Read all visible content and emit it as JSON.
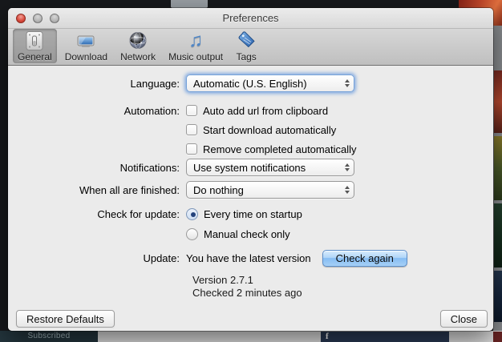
{
  "window": {
    "title": "Preferences",
    "toolbar": {
      "items": [
        {
          "label": "General",
          "icon": "switch-icon",
          "selected": true
        },
        {
          "label": "Download",
          "icon": "monitor-icon",
          "selected": false
        },
        {
          "label": "Network",
          "icon": "globe-icon",
          "selected": false
        },
        {
          "label": "Music output",
          "icon": "music-note-icon",
          "selected": false
        },
        {
          "label": "Tags",
          "icon": "tag-icon",
          "selected": false
        }
      ]
    },
    "form": {
      "language": {
        "label": "Language:",
        "value": "Automatic (U.S. English)"
      },
      "automation": {
        "label": "Automation:",
        "checkboxes": [
          {
            "label": "Auto add url from clipboard",
            "checked": false
          },
          {
            "label": "Start download automatically",
            "checked": false
          },
          {
            "label": "Remove completed automatically",
            "checked": false
          }
        ]
      },
      "notifications": {
        "label": "Notifications:",
        "value": "Use system notifications"
      },
      "when_finished": {
        "label": "When all are finished:",
        "value": "Do nothing"
      },
      "check_for_update": {
        "label": "Check for update:",
        "options": [
          {
            "label": "Every time on startup",
            "selected": true
          },
          {
            "label": "Manual check only",
            "selected": false
          }
        ]
      },
      "update": {
        "label": "Update:",
        "status": "You have the latest version",
        "button": "Check again"
      },
      "version_line1": "Version 2.7.1",
      "version_line2": "Checked 2 minutes ago"
    },
    "footer": {
      "restore_button": "Restore Defaults",
      "close_button": "Close"
    }
  },
  "background": {
    "subscribed_fragment": "Subscribed",
    "facebook_icon": "f"
  },
  "colors": {
    "focus_ring": "#76a2d8",
    "aqua_button_top": "#d9ecfd",
    "aqua_button_bottom": "#86bdf3",
    "radio_dot": "#23427c",
    "content_bg": "#ebebeb"
  }
}
